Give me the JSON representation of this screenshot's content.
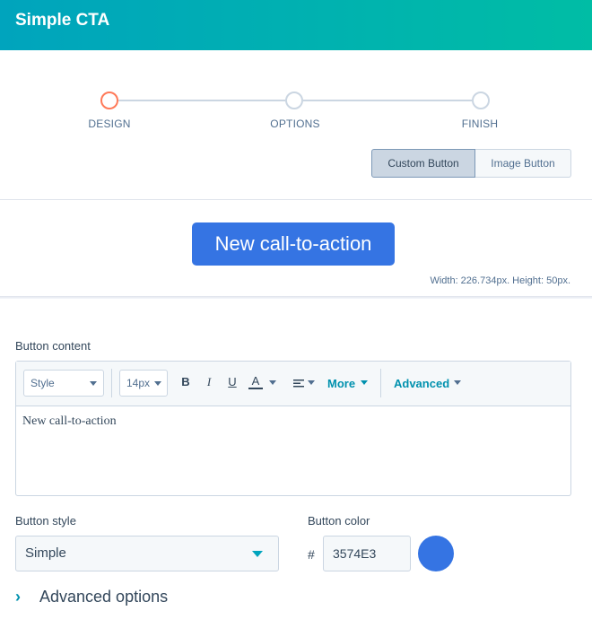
{
  "header": {
    "title": "Simple CTA"
  },
  "stepper": {
    "steps": [
      {
        "label": "DESIGN",
        "active": true
      },
      {
        "label": "OPTIONS",
        "active": false
      },
      {
        "label": "FINISH",
        "active": false
      }
    ]
  },
  "button_type_toggle": {
    "options": [
      "Custom Button",
      "Image Button"
    ],
    "selected": "Custom Button"
  },
  "preview": {
    "cta_text": "New call-to-action",
    "dimensions": "Width: 226.734px. Height: 50px."
  },
  "button_content": {
    "label": "Button content",
    "toolbar": {
      "style_select": "Style",
      "size_select": "14px",
      "bold_icon": "B",
      "italic_icon": "I",
      "underline_icon": "U",
      "text_color_icon": "A",
      "more_label": "More",
      "advanced_label": "Advanced"
    },
    "body_text": "New call-to-action"
  },
  "button_style": {
    "label": "Button style",
    "value": "Simple"
  },
  "button_color": {
    "label": "Button color",
    "hash": "#",
    "value": "3574E3",
    "swatch": "#3574e3"
  },
  "advanced_options": {
    "label": "Advanced options",
    "chevron": "›"
  },
  "colors": {
    "header_gradient_start": "#00a4bd",
    "header_gradient_end": "#00bda5",
    "active_step": "#ff7a59",
    "cta": "#3574e3",
    "link": "#0091ae"
  }
}
